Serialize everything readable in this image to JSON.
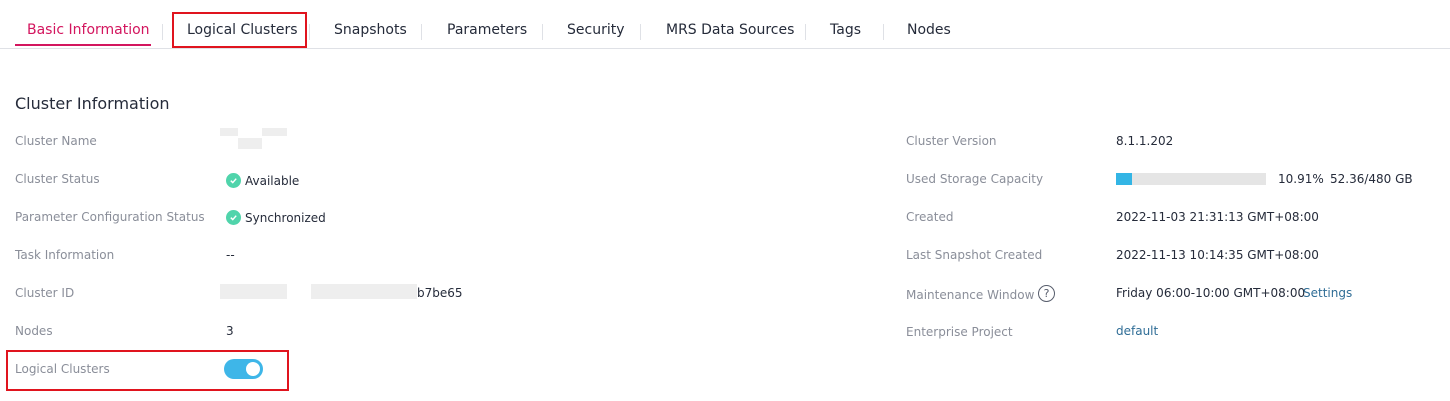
{
  "tabs": [
    {
      "label": "Basic Information",
      "active": true
    },
    {
      "label": "Logical Clusters",
      "active": false
    },
    {
      "label": "Snapshots",
      "active": false
    },
    {
      "label": "Parameters",
      "active": false
    },
    {
      "label": "Security",
      "active": false
    },
    {
      "label": "MRS Data Sources",
      "active": false
    },
    {
      "label": "Tags",
      "active": false
    },
    {
      "label": "Nodes",
      "active": false
    }
  ],
  "section": {
    "title": "Cluster Information"
  },
  "left": {
    "cluster_name": {
      "label": "Cluster Name"
    },
    "cluster_status": {
      "label": "Cluster Status",
      "value": "Available",
      "icon": "check-circle-icon"
    },
    "param_status": {
      "label": "Parameter Configuration Status",
      "value": "Synchronized",
      "icon": "check-circle-icon"
    },
    "task_info": {
      "label": "Task Information",
      "value": "--"
    },
    "cluster_id": {
      "label": "Cluster ID",
      "value_suffix": "b7be65"
    },
    "nodes": {
      "label": "Nodes",
      "value": "3"
    },
    "logical_clusters": {
      "label": "Logical Clusters",
      "enabled": true
    }
  },
  "right": {
    "version": {
      "label": "Cluster Version",
      "value": "8.1.1.202"
    },
    "storage": {
      "label": "Used Storage Capacity",
      "percent_text": "10.91%",
      "fraction": 0.1091,
      "capacity": "52.36/480 GB"
    },
    "created": {
      "label": "Created",
      "value": "2022-11-03 21:31:13 GMT+08:00"
    },
    "last_snapshot": {
      "label": "Last Snapshot Created",
      "value": "2022-11-13 10:14:35 GMT+08:00"
    },
    "maintenance": {
      "label": "Maintenance Window",
      "value": "Friday 06:00-10:00 GMT+08:00",
      "settings_label": "Settings",
      "help_icon": "?"
    },
    "enterprise": {
      "label": "Enterprise Project",
      "value": "default"
    }
  },
  "colors": {
    "accent": "#d3155e",
    "highlight": "#e0141e",
    "link": "#2f6d96",
    "success": "#50d4ab",
    "toggle": "#3eb6e8",
    "bar": "#33b5e5"
  }
}
